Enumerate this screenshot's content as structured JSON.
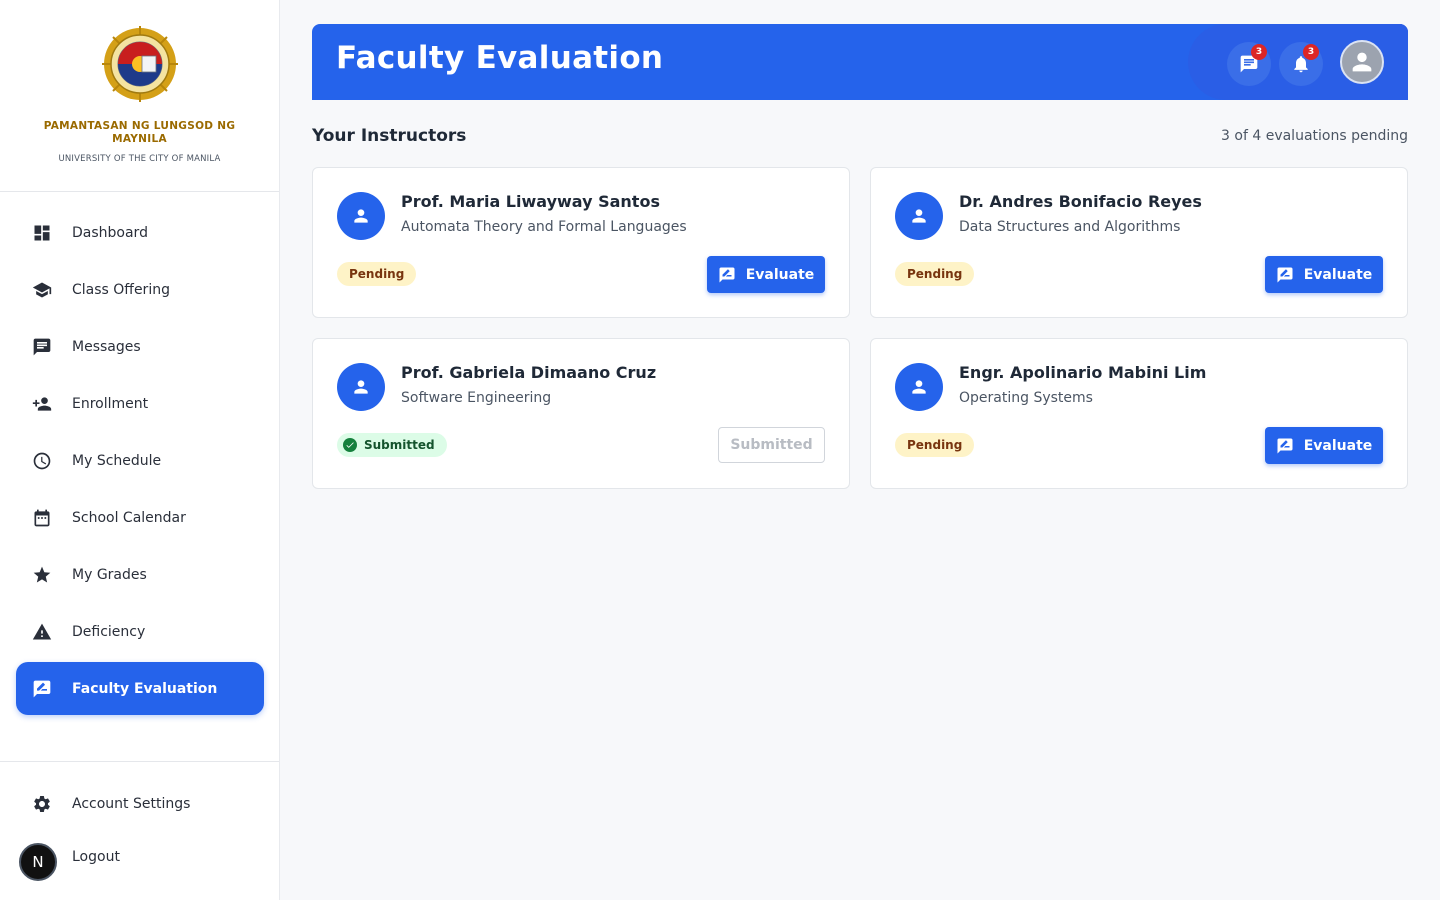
{
  "brand": {
    "name": "PAMANTASAN NG LUNGSOD NG MAYNILA",
    "subtitle": "UNIVERSITY OF THE CITY OF MANILA"
  },
  "sidebar": {
    "items": [
      {
        "label": "Dashboard",
        "icon": "dashboard-icon"
      },
      {
        "label": "Class Offering",
        "icon": "graduation-cap-icon"
      },
      {
        "label": "Messages",
        "icon": "chat-icon"
      },
      {
        "label": "Enrollment",
        "icon": "person-add-icon"
      },
      {
        "label": "My Schedule",
        "icon": "clock-icon"
      },
      {
        "label": "School Calendar",
        "icon": "calendar-icon"
      },
      {
        "label": "My Grades",
        "icon": "star-icon"
      },
      {
        "label": "Deficiency",
        "icon": "warning-icon"
      },
      {
        "label": "Faculty Evaluation",
        "icon": "rate-review-icon",
        "active": true
      }
    ],
    "account_settings": "Account Settings",
    "logout": "Logout",
    "avatar_letter": "N"
  },
  "header": {
    "title": "Faculty Evaluation",
    "messages_badge": "3",
    "notifications_badge": "3"
  },
  "main": {
    "section_title": "Your Instructors",
    "pending_summary": "3 of 4 evaluations pending",
    "instructors": [
      {
        "name": "Prof. Maria Liwayway Santos",
        "course": "Automata Theory and Formal Languages",
        "status": "Pending",
        "action": "Evaluate"
      },
      {
        "name": "Dr. Andres Bonifacio Reyes",
        "course": "Data Structures and Algorithms",
        "status": "Pending",
        "action": "Evaluate"
      },
      {
        "name": "Prof. Gabriela Dimaano Cruz",
        "course": "Software Engineering",
        "status": "Submitted",
        "action": "Submitted"
      },
      {
        "name": "Engr. Apolinario Mabini Lim",
        "course": "Operating Systems",
        "status": "Pending",
        "action": "Evaluate"
      }
    ]
  },
  "colors": {
    "primary": "#2563eb",
    "pending_bg": "#fef3c7",
    "submitted_bg": "#dcfce7",
    "badge": "#dc2626",
    "brand_gold": "#9a6a00"
  }
}
